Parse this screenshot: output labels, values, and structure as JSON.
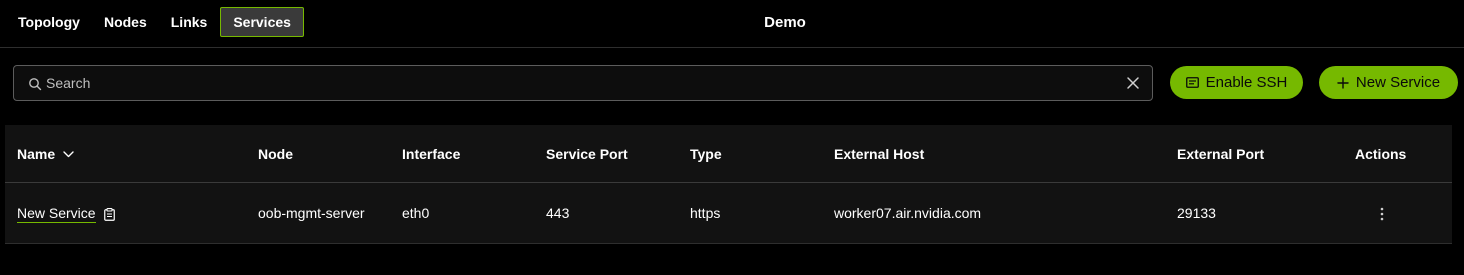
{
  "nav": {
    "tabs": [
      {
        "label": "Topology"
      },
      {
        "label": "Nodes"
      },
      {
        "label": "Links"
      },
      {
        "label": "Services",
        "active": true
      }
    ]
  },
  "app_title": "Demo",
  "search": {
    "placeholder": "Search",
    "value": "",
    "icon": "search-icon",
    "clear_icon": "close-icon"
  },
  "buttons": {
    "enable_ssh": {
      "label": "Enable SSH",
      "icon": "terminal-icon"
    },
    "new_service": {
      "label": "New Service",
      "icon": "plus-icon"
    }
  },
  "colors": {
    "accent": "#76b900",
    "background": "#000000",
    "table_bg": "#121212"
  },
  "table": {
    "columns": [
      "Name",
      "Node",
      "Interface",
      "Service Port",
      "Type",
      "External Host",
      "External Port",
      "Actions"
    ],
    "sort": {
      "column": "Name",
      "icon": "chevron-down-icon"
    },
    "rows": [
      {
        "name": "New Service",
        "node": "oob-mgmt-server",
        "interface": "eth0",
        "service_port": "443",
        "type": "https",
        "external_host": "worker07.air.nvidia.com",
        "external_port": "29133",
        "actions_icon": "more-vertical-icon"
      }
    ]
  }
}
